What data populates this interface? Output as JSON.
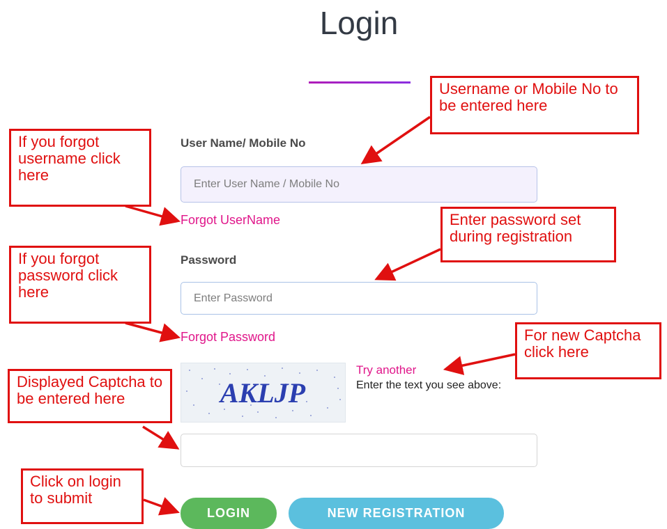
{
  "page": {
    "title": "Login"
  },
  "form": {
    "username_label": "User Name/ Mobile No",
    "username_placeholder": "Enter User Name / Mobile No",
    "forgot_username": "Forgot UserName",
    "password_label": "Password",
    "password_placeholder": "Enter Password",
    "forgot_password": "Forgot Password",
    "captcha_image_text": "AKLJP",
    "captcha_try_another": "Try another",
    "captcha_instruction": "Enter the text you see above:",
    "captcha_value": "",
    "login_button": "LOGIN",
    "register_button": "NEW REGISTRATION"
  },
  "annotations": {
    "username_hint": "Username or Mobile No to be entered here",
    "forgot_username_hint": "If you forgot username click here",
    "password_hint": "Enter password set during registration",
    "forgot_password_hint": "If you forgot password click here",
    "new_captcha_hint": "For new Captcha click here",
    "captcha_hint": "Displayed Captcha to be entered here",
    "login_hint": "Click on login to submit"
  },
  "colors": {
    "annotation_red": "#e01010",
    "link_pink": "#e0168a",
    "login_green": "#5cb85c",
    "register_blue": "#5bc0de",
    "title_underline": "#b01cb8"
  }
}
